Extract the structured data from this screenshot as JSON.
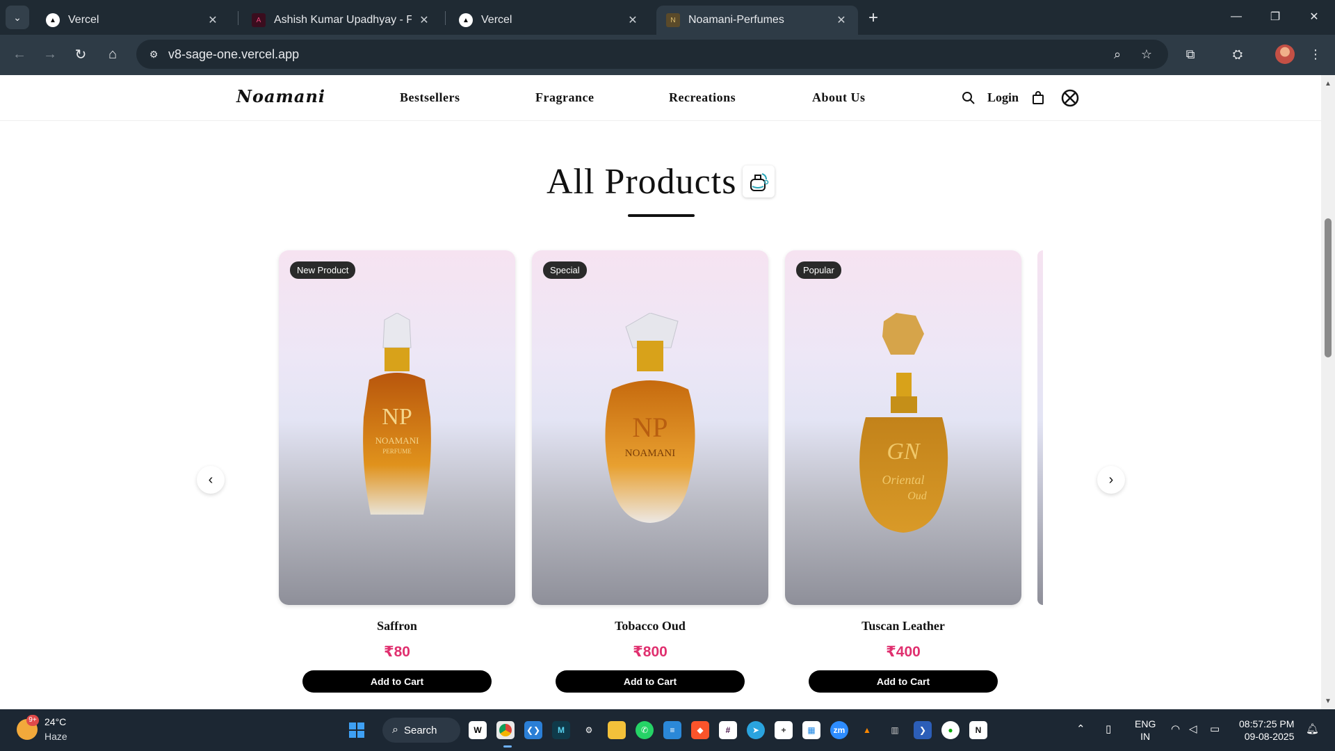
{
  "browser": {
    "tabs": [
      {
        "title": "Vercel",
        "active": false
      },
      {
        "title": "Ashish Kumar Upadhyay - Full S",
        "active": false
      },
      {
        "title": "Vercel",
        "active": false
      },
      {
        "title": "Noamani-Perfumes",
        "active": true
      }
    ],
    "url": "v8-sage-one.vercel.app"
  },
  "site": {
    "logo": "Noamani",
    "nav": [
      "Bestsellers",
      "Fragrance",
      "Recreations",
      "About Us"
    ],
    "login": "Login",
    "section_title": "All Products",
    "products": [
      {
        "badge": "New Product",
        "name": "Saffron",
        "price": "₹80",
        "cta": "Add to Cart",
        "bottle_text": "NP",
        "bottle_sub": "NOAMANI",
        "bottle_sub2": "PERFUME"
      },
      {
        "badge": "Special",
        "name": "Tobacco Oud",
        "price": "₹800",
        "cta": "Add to Cart",
        "bottle_text": "NP",
        "bottle_sub": "NOAMANI",
        "bottle_sub2": ""
      },
      {
        "badge": "Popular",
        "name": "Tuscan Leather",
        "price": "₹400",
        "cta": "Add to Cart",
        "bottle_text": "GN",
        "bottle_sub": "Oriental",
        "bottle_sub2": "Oud"
      }
    ]
  },
  "taskbar": {
    "weather": {
      "temp": "24°C",
      "condition": "Haze",
      "badge": "9+"
    },
    "search_label": "Search",
    "lang_line1": "ENG",
    "lang_line2": "IN",
    "time": "08:57:25 PM",
    "date": "09-08-2025"
  },
  "colors": {
    "price": "#e0306f",
    "button": "#000000",
    "chrome": "#2e3b46"
  }
}
